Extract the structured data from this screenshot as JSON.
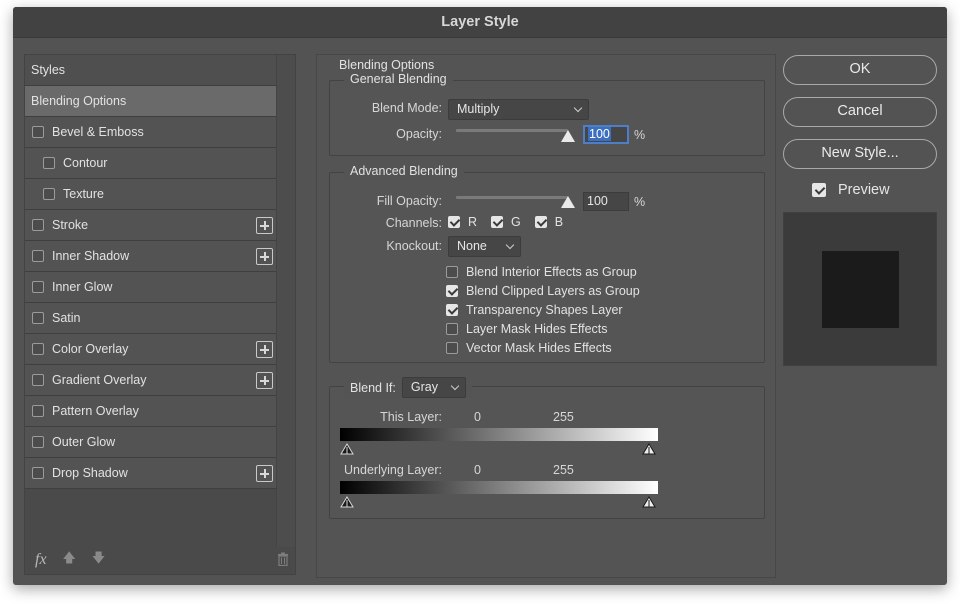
{
  "window": {
    "title": "Layer Style"
  },
  "styles_panel": {
    "items": [
      {
        "label": "Styles",
        "level": 0,
        "checkbox": false,
        "plus": false,
        "selected": false,
        "header": true
      },
      {
        "label": "Blending Options",
        "level": 0,
        "checkbox": false,
        "plus": false,
        "selected": true
      },
      {
        "label": "Bevel & Emboss",
        "level": 1,
        "checkbox": true,
        "checked": false,
        "plus": false
      },
      {
        "label": "Contour",
        "level": 2,
        "checkbox": true,
        "checked": false,
        "plus": false
      },
      {
        "label": "Texture",
        "level": 2,
        "checkbox": true,
        "checked": false,
        "plus": false
      },
      {
        "label": "Stroke",
        "level": 1,
        "checkbox": true,
        "checked": false,
        "plus": true
      },
      {
        "label": "Inner Shadow",
        "level": 1,
        "checkbox": true,
        "checked": false,
        "plus": true
      },
      {
        "label": "Inner Glow",
        "level": 1,
        "checkbox": true,
        "checked": false,
        "plus": false
      },
      {
        "label": "Satin",
        "level": 1,
        "checkbox": true,
        "checked": false,
        "plus": false
      },
      {
        "label": "Color Overlay",
        "level": 1,
        "checkbox": true,
        "checked": false,
        "plus": true
      },
      {
        "label": "Gradient Overlay",
        "level": 1,
        "checkbox": true,
        "checked": false,
        "plus": true
      },
      {
        "label": "Pattern Overlay",
        "level": 1,
        "checkbox": true,
        "checked": false,
        "plus": false
      },
      {
        "label": "Outer Glow",
        "level": 1,
        "checkbox": true,
        "checked": false,
        "plus": false
      },
      {
        "label": "Drop Shadow",
        "level": 1,
        "checkbox": true,
        "checked": false,
        "plus": true
      }
    ],
    "footer": {
      "fx_label": "fx",
      "up_icon": "arrow-up-icon",
      "down_icon": "arrow-down-icon",
      "trash_icon": "trash-icon"
    }
  },
  "blending_options": {
    "title": "Blending Options",
    "general": {
      "title": "General Blending",
      "blend_mode_label": "Blend Mode:",
      "blend_mode_value": "Multiply",
      "opacity_label": "Opacity:",
      "opacity_value": "100",
      "opacity_unit": "%",
      "opacity_fraction": 1.0
    },
    "advanced": {
      "title": "Advanced Blending",
      "fill_opacity_label": "Fill Opacity:",
      "fill_opacity_value": "100",
      "fill_opacity_unit": "%",
      "fill_opacity_fraction": 1.0,
      "channels_label": "Channels:",
      "channels": [
        {
          "label": "R",
          "checked": true
        },
        {
          "label": "G",
          "checked": true
        },
        {
          "label": "B",
          "checked": true
        }
      ],
      "knockout_label": "Knockout:",
      "knockout_value": "None",
      "options": [
        {
          "label": "Blend Interior Effects as Group",
          "checked": false
        },
        {
          "label": "Blend Clipped Layers as Group",
          "checked": true
        },
        {
          "label": "Transparency Shapes Layer",
          "checked": true
        },
        {
          "label": "Layer Mask Hides Effects",
          "checked": false
        },
        {
          "label": "Vector Mask Hides Effects",
          "checked": false
        }
      ]
    },
    "blend_if": {
      "label": "Blend If:",
      "value": "Gray",
      "this_layer_label": "This Layer:",
      "this_layer_min": "0",
      "this_layer_max": "255",
      "underlying_label": "Underlying Layer:",
      "underlying_min": "0",
      "underlying_max": "255"
    }
  },
  "buttons": {
    "ok": "OK",
    "cancel": "Cancel",
    "new_style": "New Style..."
  },
  "preview": {
    "label": "Preview",
    "checked": true
  },
  "colors": {
    "dialog_bg": "#535353",
    "titlebar_bg": "#424242",
    "selection": "#6a6a6a",
    "focus": "#4e7ec7"
  }
}
